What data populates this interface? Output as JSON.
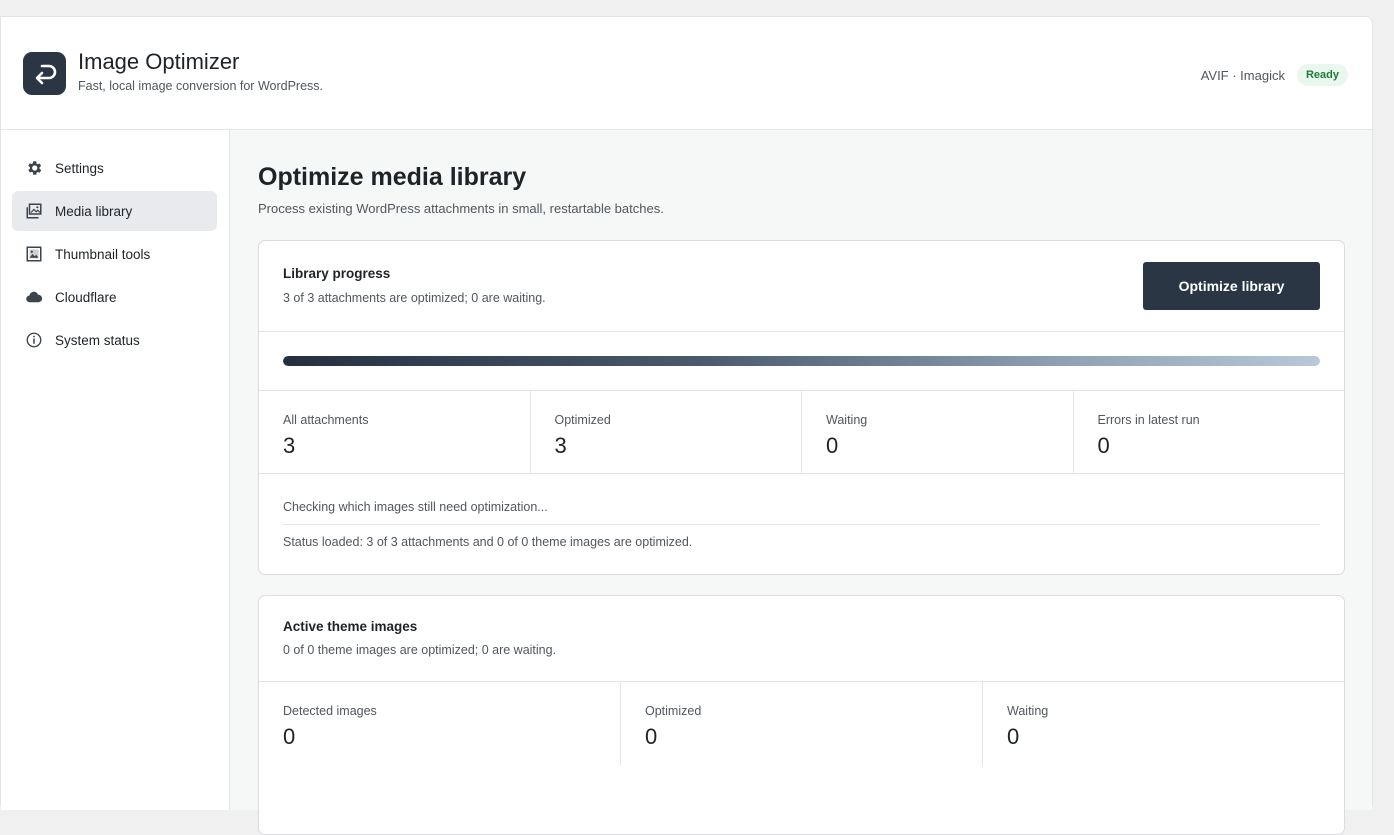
{
  "header": {
    "title": "Image Optimizer",
    "subtitle": "Fast, local image conversion for WordPress.",
    "engine": "AVIF · Imagick",
    "status_badge": "Ready"
  },
  "sidebar": {
    "items": [
      {
        "label": "Settings",
        "icon": "gear-icon",
        "active": false
      },
      {
        "label": "Media library",
        "icon": "media-library-icon",
        "active": true
      },
      {
        "label": "Thumbnail tools",
        "icon": "image-icon",
        "active": false
      },
      {
        "label": "Cloudflare",
        "icon": "cloud-icon",
        "active": false
      },
      {
        "label": "System status",
        "icon": "info-icon",
        "active": false
      }
    ]
  },
  "main": {
    "title": "Optimize media library",
    "subtitle": "Process existing WordPress attachments in small, restartable batches.",
    "library": {
      "title": "Library progress",
      "summary": "3 of 3 attachments are optimized; 0 are waiting.",
      "button": "Optimize library",
      "progress": 1.0,
      "stats": [
        {
          "label": "All attachments",
          "value": "3"
        },
        {
          "label": "Optimized",
          "value": "3"
        },
        {
          "label": "Waiting",
          "value": "0"
        },
        {
          "label": "Errors in latest run",
          "value": "0"
        }
      ],
      "checking_text": "Checking which images still need optimization...",
      "status_text": "Status loaded: 3 of 3 attachments and 0 of 0 theme images are optimized."
    },
    "theme": {
      "title": "Active theme images",
      "summary": "0 of 0 theme images are optimized; 0 are waiting.",
      "stats": [
        {
          "label": "Detected images",
          "value": "0"
        },
        {
          "label": "Optimized",
          "value": "0"
        },
        {
          "label": "Waiting",
          "value": "0"
        }
      ]
    }
  },
  "colors": {
    "accent": "#2b3645",
    "badge_bg": "#e9f7ee",
    "badge_text": "#1f7a3a"
  }
}
